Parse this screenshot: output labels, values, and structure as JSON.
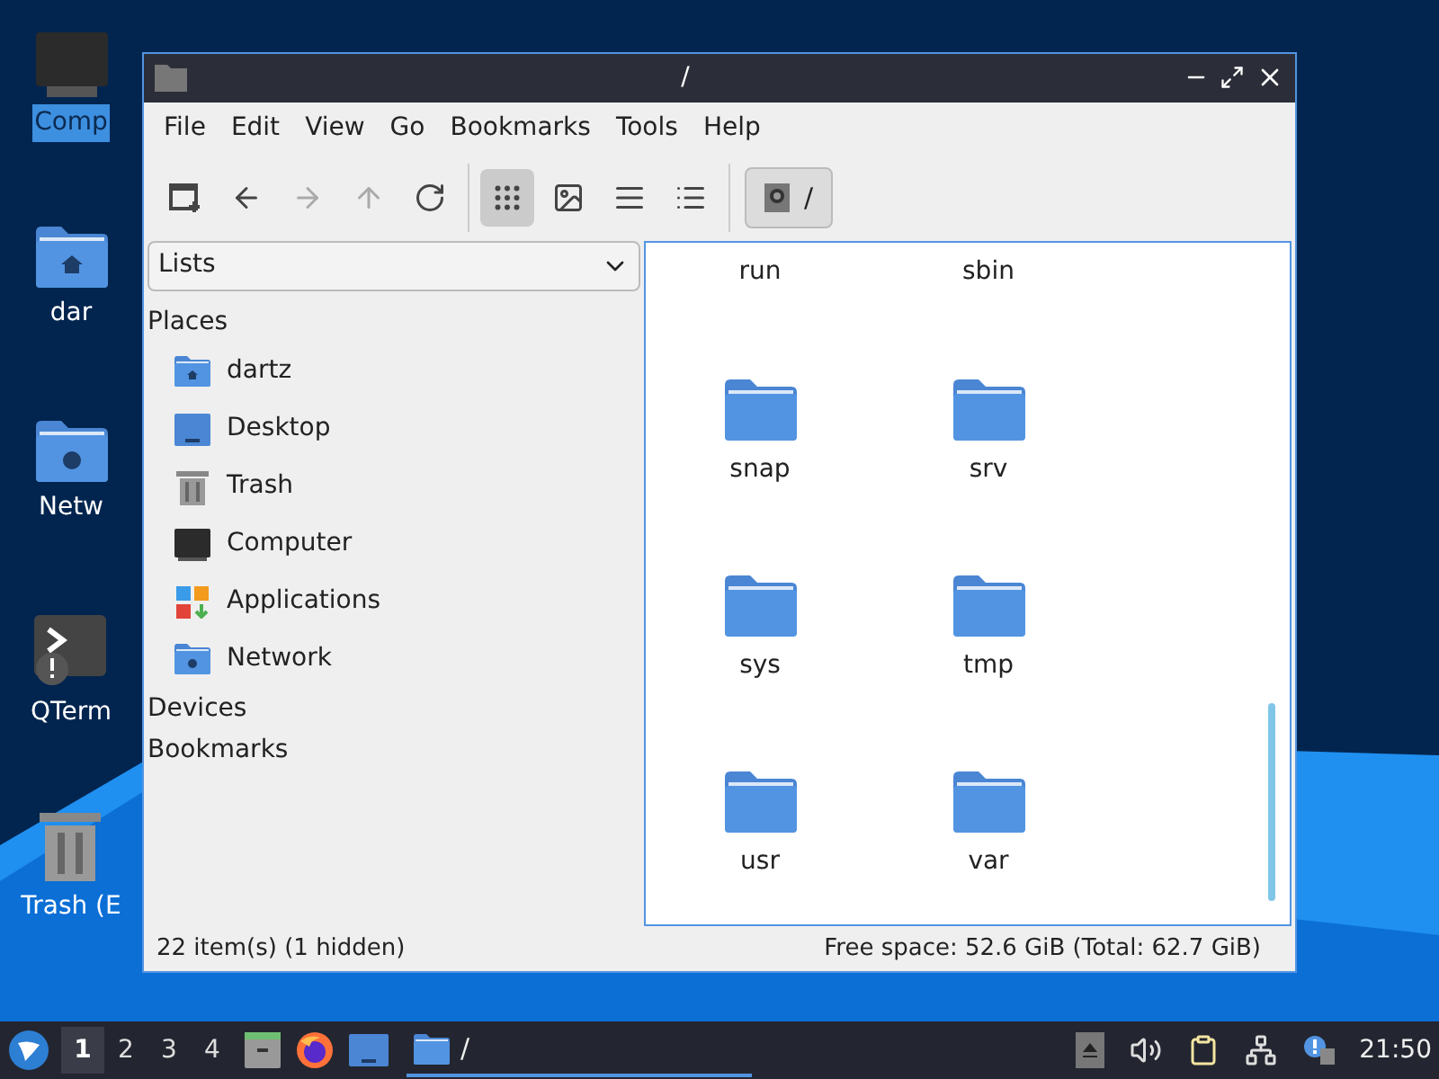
{
  "desktop_icons": [
    {
      "kind": "computer",
      "label": "Comp",
      "selected": true
    },
    {
      "kind": "home",
      "label": "dar",
      "selected": false
    },
    {
      "kind": "network",
      "label": "Netw",
      "selected": false
    },
    {
      "kind": "terminal",
      "label": "QTerm",
      "selected": false
    },
    {
      "kind": "trash",
      "label": "Trash (E",
      "selected": false
    }
  ],
  "window": {
    "title": "/"
  },
  "menu": [
    "File",
    "Edit",
    "View",
    "Go",
    "Bookmarks",
    "Tools",
    "Help"
  ],
  "toolbar": [
    {
      "kind": "new-tab",
      "disabled": false,
      "selected": false
    },
    {
      "kind": "back",
      "disabled": false,
      "selected": false
    },
    {
      "kind": "forward",
      "disabled": true,
      "selected": false
    },
    {
      "kind": "up",
      "disabled": true,
      "selected": false
    },
    {
      "kind": "reload",
      "disabled": false,
      "selected": false
    },
    {
      "kind": "sep"
    },
    {
      "kind": "icon-view",
      "disabled": false,
      "selected": true
    },
    {
      "kind": "thumbnail-view",
      "disabled": false,
      "selected": false
    },
    {
      "kind": "compact-view",
      "disabled": false,
      "selected": false
    },
    {
      "kind": "detail-view",
      "disabled": false,
      "selected": false
    },
    {
      "kind": "sep"
    }
  ],
  "path_button": {
    "label": "/"
  },
  "sidebar": {
    "dropdown": "Lists",
    "sections": [
      {
        "title": "Places",
        "items": [
          {
            "kind": "home",
            "label": "dartz"
          },
          {
            "kind": "desktop",
            "label": "Desktop"
          },
          {
            "kind": "trash",
            "label": "Trash"
          },
          {
            "kind": "computer",
            "label": "Computer"
          },
          {
            "kind": "apps",
            "label": "Applications"
          },
          {
            "kind": "network",
            "label": "Network"
          }
        ]
      },
      {
        "title": "Devices"
      },
      {
        "title": "Bookmarks"
      }
    ]
  },
  "files": [
    "run",
    "sbin",
    "snap",
    "srv",
    "sys",
    "tmp",
    "usr",
    "var"
  ],
  "status_bar": {
    "items": "22 item(s) (1 hidden)",
    "space": "Free space: 52.6 GiB (Total: 62.7 GiB)"
  },
  "taskbar": {
    "workspaces": [
      {
        "label": "1",
        "selected": true
      },
      {
        "label": "2",
        "selected": false
      },
      {
        "label": "3",
        "selected": false
      },
      {
        "label": "4",
        "selected": false
      }
    ],
    "launchers": [
      {
        "kind": "files"
      },
      {
        "kind": "browser"
      },
      {
        "kind": "desktop"
      }
    ],
    "tasks": [
      {
        "label": "/",
        "selected": true
      }
    ],
    "tray": [
      {
        "kind": "eject"
      },
      {
        "kind": "volume"
      },
      {
        "kind": "clipboard"
      },
      {
        "kind": "network"
      },
      {
        "kind": "notify"
      }
    ],
    "clock": "21:50"
  }
}
